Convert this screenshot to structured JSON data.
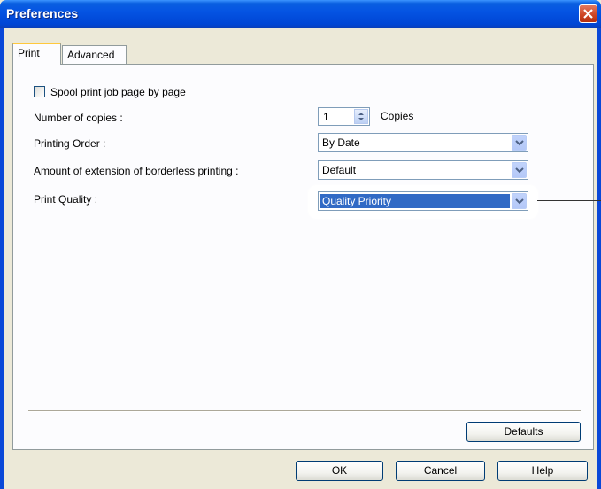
{
  "window": {
    "title": "Preferences"
  },
  "tabs": [
    {
      "label": "Print",
      "active": true
    },
    {
      "label": "Advanced",
      "active": false
    }
  ],
  "print_tab": {
    "spool_checkbox": {
      "label": "Spool print job page by page",
      "checked": false
    },
    "copies": {
      "label": "Number of copies :",
      "value": "1",
      "unit": "Copies"
    },
    "printing_order": {
      "label": "Printing Order :",
      "value": "By Date"
    },
    "borderless": {
      "label": "Amount of extension of borderless printing :",
      "value": "Default"
    },
    "print_quality": {
      "label": "Print Quality :",
      "value": "Quality Priority"
    }
  },
  "buttons": {
    "defaults": "Defaults",
    "ok": "OK",
    "cancel": "Cancel",
    "help": "Help"
  },
  "icons": {
    "close": "close-icon",
    "spin_up": "spin-up-icon",
    "spin_down": "spin-down-icon",
    "dropdown": "chevron-down-icon"
  },
  "colors": {
    "titlebar": "#0554e3",
    "selection": "#316ac5",
    "window_bg": "#ece9d8",
    "close_button": "#cc4322"
  }
}
